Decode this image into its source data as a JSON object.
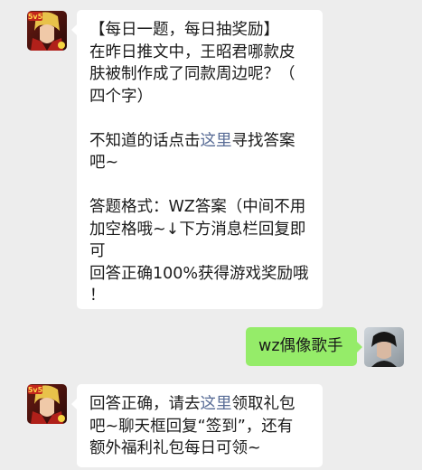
{
  "messages": [
    {
      "sender": "official-account",
      "avatar_icon": "game-hero-avatar-icon",
      "lines": {
        "l1": "【每日一题，每日抽奖励】",
        "l2": "在昨日推文中，王昭君哪款皮",
        "l3": "肤被制作成了同款周边呢？（",
        "l4": "四个字）",
        "l5a": "不知道的话点击",
        "l5link": "这里",
        "l5b": "寻找答案",
        "l6": "吧~",
        "l7": "答题格式：WZ答案（中间不用",
        "l8": "加空格哦~↓下方消息栏回复即",
        "l9": "可",
        "l10": "回答正确100%获得游戏奖励哦",
        "l11": "！"
      }
    },
    {
      "sender": "user",
      "avatar_icon": "user-portrait-avatar-icon",
      "text": "wz偶像歌手"
    },
    {
      "sender": "official-account",
      "avatar_icon": "game-hero-avatar-icon",
      "lines": {
        "l1a": "回答正确，请去",
        "l1link": "这里",
        "l1b": "领取礼包",
        "l2": "吧~聊天框回复“签到”，还有",
        "l3": "额外福利礼包每日可领~"
      }
    }
  ],
  "colors": {
    "background": "#ededed",
    "incoming_bubble": "#ffffff",
    "outgoing_bubble": "#95ec69",
    "link": "#576b95"
  }
}
